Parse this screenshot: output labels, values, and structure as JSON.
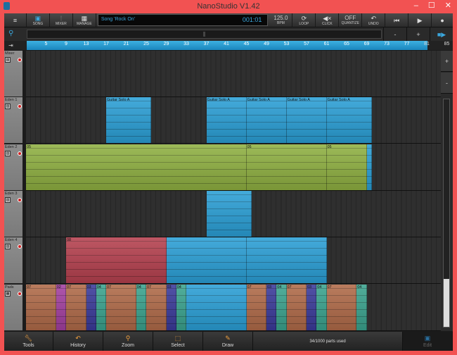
{
  "window": {
    "title": "NanoStudio V1.42",
    "min": "–",
    "max": "☐",
    "close": "✕"
  },
  "toolbar": {
    "menu": "≡",
    "song": "SONG",
    "mixer": "MIXER",
    "manage": "MANAGE",
    "song_name": "Song 'Rock On'",
    "position": "001:01",
    "tempo": "125.0",
    "tempo_unit": "BPM",
    "loop": "LOOP",
    "click": "CLICK",
    "quantize_value": "OFF",
    "quantize": "QUANTIZE",
    "undo": "UNDO",
    "rewind": "⏮",
    "play": "▶",
    "record": "●"
  },
  "zoom": {
    "minus": "-",
    "plus": "+",
    "icon": "⚲"
  },
  "ruler": {
    "ticks": [
      "5",
      "9",
      "13",
      "17",
      "21",
      "25",
      "29",
      "33",
      "37",
      "41",
      "45",
      "49",
      "53",
      "57",
      "61",
      "65",
      "69",
      "73",
      "77",
      "81",
      "85"
    ]
  },
  "tracks": [
    {
      "name": "Mixer",
      "icon": "▤",
      "parts": []
    },
    {
      "name": "Eden 1",
      "icon": "▥",
      "parts": [
        {
          "label": "Guitar Solo A",
          "start": 17,
          "end": 26,
          "color": "#2a9fd6"
        },
        {
          "label": "Guitar Solo A",
          "start": 37,
          "end": 45,
          "color": "#2a9fd6"
        },
        {
          "label": "Guitar Solo A",
          "start": 45,
          "end": 53,
          "color": "#2a9fd6"
        },
        {
          "label": "Guitar Solo A",
          "start": 53,
          "end": 61,
          "color": "#2a9fd6"
        },
        {
          "label": "Guitar Solo A",
          "start": 61,
          "end": 70,
          "color": "#2a9fd6"
        }
      ]
    },
    {
      "name": "Eden 2",
      "icon": "▥",
      "parts": [
        {
          "label": "05",
          "start": 1,
          "end": 45,
          "color": "#8fb041"
        },
        {
          "label": "05",
          "start": 45,
          "end": 61,
          "color": "#8fb041"
        },
        {
          "label": "05",
          "start": 61,
          "end": 69,
          "color": "#8fb041"
        },
        {
          "label": "",
          "start": 69,
          "end": 70,
          "color": "#2a9fd6"
        }
      ]
    },
    {
      "name": "Eden 3",
      "icon": "▥",
      "parts": [
        {
          "label": "",
          "start": 37,
          "end": 46,
          "color": "#2a9fd6"
        }
      ]
    },
    {
      "name": "Eden 4",
      "icon": "▥",
      "parts": [
        {
          "label": "08",
          "start": 9,
          "end": 29,
          "color": "#b5404e"
        },
        {
          "label": "",
          "start": 29,
          "end": 45,
          "color": "#2a9fd6"
        },
        {
          "label": "",
          "start": 45,
          "end": 61,
          "color": "#2a9fd6"
        }
      ]
    },
    {
      "name": "Pads",
      "icon": "▦",
      "parts": [
        {
          "label": "07",
          "start": 1,
          "end": 7,
          "color": "#b06a48"
        },
        {
          "label": "02",
          "start": 7,
          "end": 9,
          "color": "#a33fa0"
        },
        {
          "label": "07",
          "start": 9,
          "end": 13,
          "color": "#b06a48"
        },
        {
          "label": "03",
          "start": 13,
          "end": 15,
          "color": "#3a3a9a"
        },
        {
          "label": "04",
          "start": 15,
          "end": 17,
          "color": "#3aa38e"
        },
        {
          "label": "07",
          "start": 17,
          "end": 23,
          "color": "#b06a48"
        },
        {
          "label": "04",
          "start": 23,
          "end": 25,
          "color": "#3aa38e"
        },
        {
          "label": "07",
          "start": 25,
          "end": 29,
          "color": "#b06a48"
        },
        {
          "label": "03",
          "start": 29,
          "end": 31,
          "color": "#3a3a9a"
        },
        {
          "label": "04",
          "start": 31,
          "end": 33,
          "color": "#3aa38e"
        },
        {
          "label": "",
          "start": 33,
          "end": 45,
          "color": "#2a9fd6"
        },
        {
          "label": "07",
          "start": 45,
          "end": 49,
          "color": "#b06a48"
        },
        {
          "label": "03",
          "start": 49,
          "end": 51,
          "color": "#3a3a9a"
        },
        {
          "label": "04",
          "start": 51,
          "end": 53,
          "color": "#3aa38e"
        },
        {
          "label": "07",
          "start": 53,
          "end": 57,
          "color": "#b06a48"
        },
        {
          "label": "03",
          "start": 57,
          "end": 59,
          "color": "#3a3a9a"
        },
        {
          "label": "04",
          "start": 59,
          "end": 61,
          "color": "#3aa38e"
        },
        {
          "label": "07",
          "start": 61,
          "end": 67,
          "color": "#b06a48"
        },
        {
          "label": "04",
          "start": 67,
          "end": 69,
          "color": "#3aa38e"
        }
      ]
    }
  ],
  "side": {
    "plus": "+",
    "minus": "-"
  },
  "bottom": {
    "tools": "Tools",
    "history": "History",
    "zoom": "Zoom",
    "select": "Select",
    "draw": "Draw",
    "status": "34/1000 parts used",
    "edit": "Edit"
  }
}
